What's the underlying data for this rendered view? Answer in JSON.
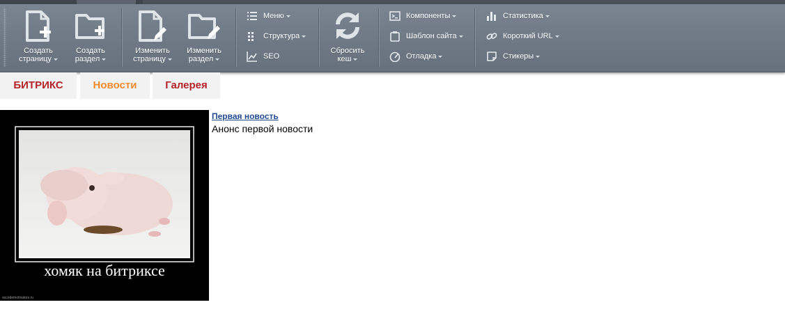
{
  "admin_panel": {
    "create_page": {
      "line1": "Создать",
      "line2": "страницу"
    },
    "create_section": {
      "line1": "Создать",
      "line2": "раздел"
    },
    "edit_page": {
      "line1": "Изменить",
      "line2": "страницу"
    },
    "edit_section": {
      "line1": "Изменить",
      "line2": "раздел"
    },
    "menu": {
      "label": "Меню"
    },
    "structure": {
      "label": "Структура"
    },
    "seo": {
      "label": "SEO"
    },
    "reset_cache": {
      "line1": "Сбросить",
      "line2": "кеш"
    },
    "components": {
      "label": "Компоненты"
    },
    "site_template": {
      "label": "Шаблон сайта"
    },
    "debug": {
      "label": "Отладка"
    },
    "statistics": {
      "label": "Статистика"
    },
    "short_url": {
      "label": "Короткий URL"
    },
    "stickers": {
      "label": "Стикеры"
    }
  },
  "nav": {
    "tabs": [
      {
        "label": "БИТРИКС"
      },
      {
        "label": "Новости"
      },
      {
        "label": "Галерея"
      }
    ]
  },
  "news": {
    "image": {
      "caption": "хомяк на битриксе",
      "watermark": "secodemotivators.ru"
    },
    "title": "Первая новость",
    "preview": "Анонс первой новости"
  },
  "colors": {
    "panel": "#707b87",
    "tab_red": "#b4212a",
    "tab_active": "#f08a2b",
    "link": "#1f4a8f"
  }
}
